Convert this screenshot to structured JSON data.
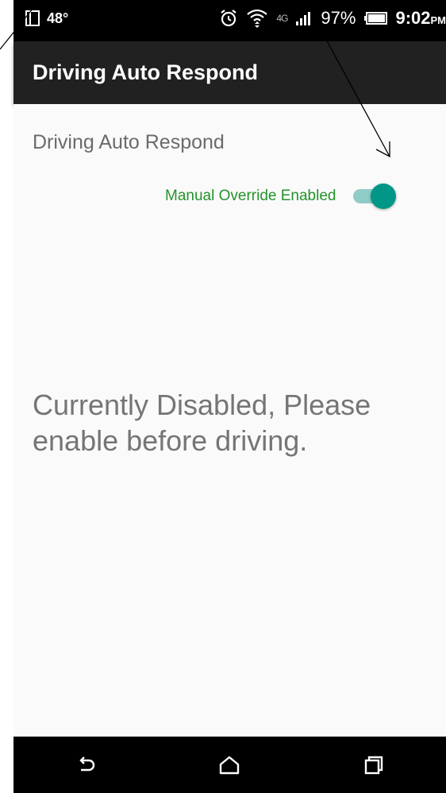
{
  "status_bar": {
    "temperature": "48°",
    "battery": "97%",
    "time": "9:02",
    "time_suffix": "PM",
    "network": "4G",
    "icons": [
      "notification-icon",
      "alarm-icon",
      "wifi-icon",
      "signal-icon",
      "battery-icon"
    ]
  },
  "app_bar": {
    "title": "Driving Auto Respond"
  },
  "content": {
    "header": "Driving Auto Respond",
    "override_label": "Manual Override Enabled",
    "override_switch_on": true,
    "status_message": "Currently Disabled, Please enable before driving."
  },
  "nav_bar": {
    "buttons": [
      "back-icon",
      "home-icon",
      "recents-icon"
    ]
  },
  "colors": {
    "app_bar": "#212121",
    "override_label": "#23932a",
    "switch_thumb": "#009688",
    "switch_track": "#8fccc6",
    "status_text": "#757575"
  }
}
